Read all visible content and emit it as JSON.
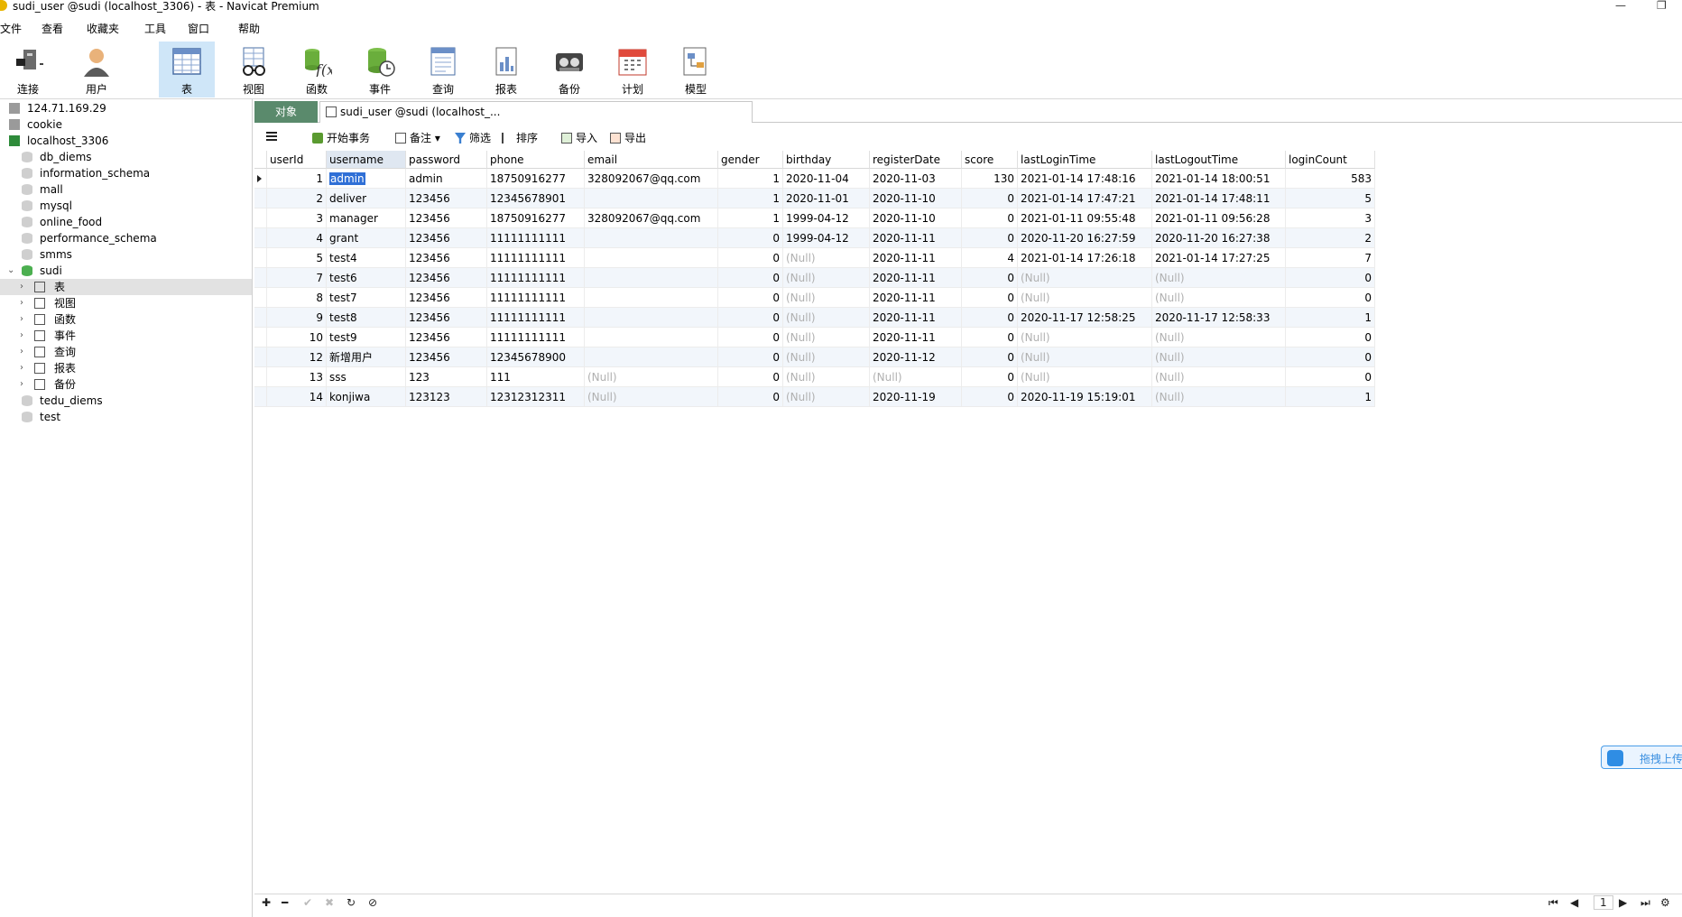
{
  "window": {
    "title": "sudi_user @sudi (localhost_3306) - 表 - Navicat Premium"
  },
  "menu": [
    "文件",
    "查看",
    "收藏夹",
    "工具",
    "窗口",
    "帮助"
  ],
  "toolbar": [
    {
      "label": "连接",
      "icon": "plug-icon"
    },
    {
      "label": "用户",
      "icon": "user-icon"
    },
    {
      "label": "表",
      "icon": "table-icon"
    },
    {
      "label": "视图",
      "icon": "view-glasses-icon"
    },
    {
      "label": "函数",
      "icon": "function-icon"
    },
    {
      "label": "事件",
      "icon": "event-icon"
    },
    {
      "label": "查询",
      "icon": "query-icon"
    },
    {
      "label": "报表",
      "icon": "report-icon"
    },
    {
      "label": "备份",
      "icon": "backup-icon"
    },
    {
      "label": "计划",
      "icon": "calendar-icon"
    },
    {
      "label": "模型",
      "icon": "model-icon"
    }
  ],
  "tree": [
    {
      "label": "124.71.169.29",
      "level": 0,
      "icon": "connection-icon"
    },
    {
      "label": "cookie",
      "level": 0,
      "icon": "connection-icon"
    },
    {
      "label": "localhost_3306",
      "level": 0,
      "icon": "connection-active-icon"
    },
    {
      "label": "db_diems",
      "level": 1,
      "icon": "database-icon"
    },
    {
      "label": "information_schema",
      "level": 1,
      "icon": "database-icon"
    },
    {
      "label": "mall",
      "level": 1,
      "icon": "database-icon"
    },
    {
      "label": "mysql",
      "level": 1,
      "icon": "database-icon"
    },
    {
      "label": "online_food",
      "level": 1,
      "icon": "database-icon"
    },
    {
      "label": "performance_schema",
      "level": 1,
      "icon": "database-icon"
    },
    {
      "label": "smms",
      "level": 1,
      "icon": "database-icon"
    },
    {
      "label": "sudi",
      "level": 1,
      "icon": "database-open-icon",
      "expanded": true
    },
    {
      "label": "表",
      "level": 2,
      "icon": "table-icon",
      "selected": true
    },
    {
      "label": "视图",
      "level": 2,
      "icon": "view-glasses-icon"
    },
    {
      "label": "函数",
      "level": 2,
      "icon": "function-icon"
    },
    {
      "label": "事件",
      "level": 2,
      "icon": "event-icon"
    },
    {
      "label": "查询",
      "level": 2,
      "icon": "query-icon"
    },
    {
      "label": "报表",
      "level": 2,
      "icon": "report-icon"
    },
    {
      "label": "备份",
      "level": 2,
      "icon": "backup-icon"
    },
    {
      "label": "tedu_diems",
      "level": 1,
      "icon": "database-icon"
    },
    {
      "label": "test",
      "level": 1,
      "icon": "database-icon"
    }
  ],
  "tabs": {
    "objects": "对象",
    "table_tab": "sudi_user @sudi (localhost_..."
  },
  "gridbar": {
    "begin_transaction": "开始事务",
    "memo": "备注",
    "filter": "筛选",
    "sort": "排序",
    "import": "导入",
    "export": "导出"
  },
  "columns": [
    "userId",
    "username",
    "password",
    "phone",
    "email",
    "gender",
    "birthday",
    "registerDate",
    "score",
    "lastLoginTime",
    "lastLogoutTime",
    "loginCount"
  ],
  "rows": [
    [
      "1",
      "admin",
      "admin",
      "18750916277",
      "328092067@qq.com",
      "1",
      "2020-11-04",
      "2020-11-03",
      "130",
      "2021-01-14 17:48:16",
      "2021-01-14 18:00:51",
      "583"
    ],
    [
      "2",
      "deliver",
      "123456",
      "12345678901",
      "",
      "1",
      "2020-11-01",
      "2020-11-10",
      "0",
      "2021-01-14 17:47:21",
      "2021-01-14 17:48:11",
      "5"
    ],
    [
      "3",
      "manager",
      "123456",
      "18750916277",
      "328092067@qq.com",
      "1",
      "1999-04-12",
      "2020-11-10",
      "0",
      "2021-01-11 09:55:48",
      "2021-01-11 09:56:28",
      "3"
    ],
    [
      "4",
      "grant",
      "123456",
      "11111111111",
      "",
      "0",
      "1999-04-12",
      "2020-11-11",
      "0",
      "2020-11-20 16:27:59",
      "2020-11-20 16:27:38",
      "2"
    ],
    [
      "5",
      "test4",
      "123456",
      "11111111111",
      "",
      "0",
      "(Null)",
      "2020-11-11",
      "4",
      "2021-01-14 17:26:18",
      "2021-01-14 17:27:25",
      "7"
    ],
    [
      "7",
      "test6",
      "123456",
      "11111111111",
      "",
      "0",
      "(Null)",
      "2020-11-11",
      "0",
      "(Null)",
      "(Null)",
      "0"
    ],
    [
      "8",
      "test7",
      "123456",
      "11111111111",
      "",
      "0",
      "(Null)",
      "2020-11-11",
      "0",
      "(Null)",
      "(Null)",
      "0"
    ],
    [
      "9",
      "test8",
      "123456",
      "11111111111",
      "",
      "0",
      "(Null)",
      "2020-11-11",
      "0",
      "2020-11-17 12:58:25",
      "2020-11-17 12:58:33",
      "1"
    ],
    [
      "10",
      "test9",
      "123456",
      "11111111111",
      "",
      "0",
      "(Null)",
      "2020-11-11",
      "0",
      "(Null)",
      "(Null)",
      "0"
    ],
    [
      "12",
      "新增用户",
      "123456",
      "12345678900",
      "",
      "0",
      "(Null)",
      "2020-11-12",
      "0",
      "(Null)",
      "(Null)",
      "0"
    ],
    [
      "13",
      "sss",
      "123",
      "111",
      "(Null)",
      "0",
      "(Null)",
      "(Null)",
      "0",
      "(Null)",
      "(Null)",
      "0"
    ],
    [
      "14",
      "konjiwa",
      "123123",
      "12312312311",
      "(Null)",
      "0",
      "(Null)",
      "2020-11-19",
      "0",
      "2020-11-19 15:19:01",
      "(Null)",
      "1"
    ]
  ],
  "pager": {
    "page": "1"
  },
  "upload_widget": {
    "label": "拖拽上传"
  },
  "colors": {
    "accent": "#2f6fd6",
    "tab_objects": "#5a8a6c",
    "toolbar_active": "#cfe6f8",
    "null_text": "#b0b0b0"
  }
}
